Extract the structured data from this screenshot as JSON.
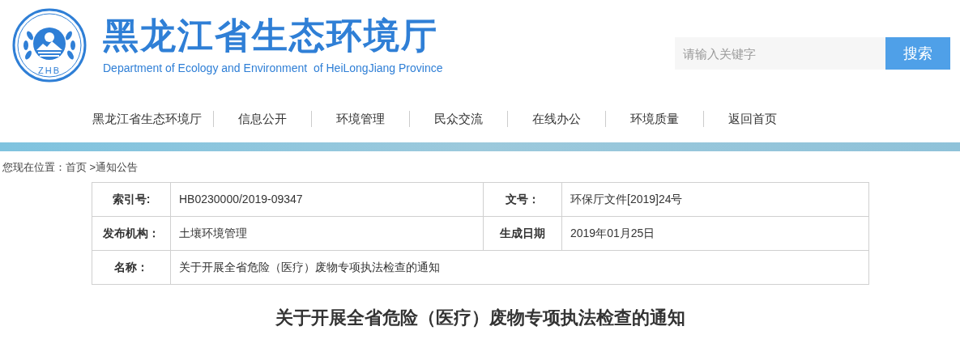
{
  "header": {
    "logo_text": "ZHB",
    "title": "黑龙江省生态环境厅",
    "subtitle": "Department of Ecology and Environment  of HeiLongJiang Province"
  },
  "search": {
    "placeholder": "请输入关键字",
    "button": "搜索"
  },
  "nav": [
    "黑龙江省生态环境厅",
    "信息公开",
    "环境管理",
    "民众交流",
    "在线办公",
    "环境质量",
    "返回首页"
  ],
  "breadcrumb": "您现在位置：首页 >通知公告",
  "info_table": [
    {
      "fields": [
        {
          "label": "索引号:",
          "value": "HB0230000/2019-09347"
        },
        {
          "label": "文号：",
          "value": "环保厅文件[2019]24号"
        }
      ]
    },
    {
      "fields": [
        {
          "label": "发布机构：",
          "value": "土壤环境管理"
        },
        {
          "label": "生成日期",
          "value": "2019年01月25日"
        }
      ]
    },
    {
      "fields": [
        {
          "label": "名称：",
          "value": "关于开展全省危险（医疗）废物专项执法检查的通知"
        }
      ]
    }
  ],
  "article_title": "关于开展全省危险（医疗）废物专项执法检查的通知"
}
